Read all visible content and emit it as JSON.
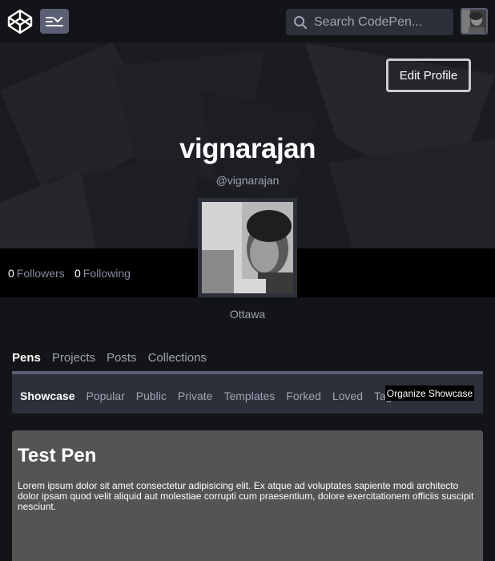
{
  "topbar": {
    "search_placeholder": "Search CodePen..."
  },
  "hero": {
    "edit_label": "Edit Profile",
    "display_name": "vignarajan",
    "handle": "@vignarajan"
  },
  "stats": {
    "followers_count": "0",
    "followers_label": "Followers",
    "following_count": "0",
    "following_label": "Following"
  },
  "location": "Ottawa",
  "tabs": [
    {
      "label": "Pens"
    },
    {
      "label": "Projects"
    },
    {
      "label": "Posts"
    },
    {
      "label": "Collections"
    }
  ],
  "subtabs": [
    {
      "label": "Showcase"
    },
    {
      "label": "Popular"
    },
    {
      "label": "Public"
    },
    {
      "label": "Private"
    },
    {
      "label": "Templates"
    },
    {
      "label": "Forked"
    },
    {
      "label": "Loved"
    },
    {
      "label": "Tags"
    }
  ],
  "organize_label": "Organize Showcase",
  "pen": {
    "title": "Test Pen",
    "body": "Lorem ipsum dolor sit amet consectetur adipisicing elit. Ex atque ad voluptates sapiente modi architecto dolor ipsam quod velit aliquid aut molestiae corrupti cum praesentium, dolore exercitationem officiis suscipit nesciunt."
  }
}
